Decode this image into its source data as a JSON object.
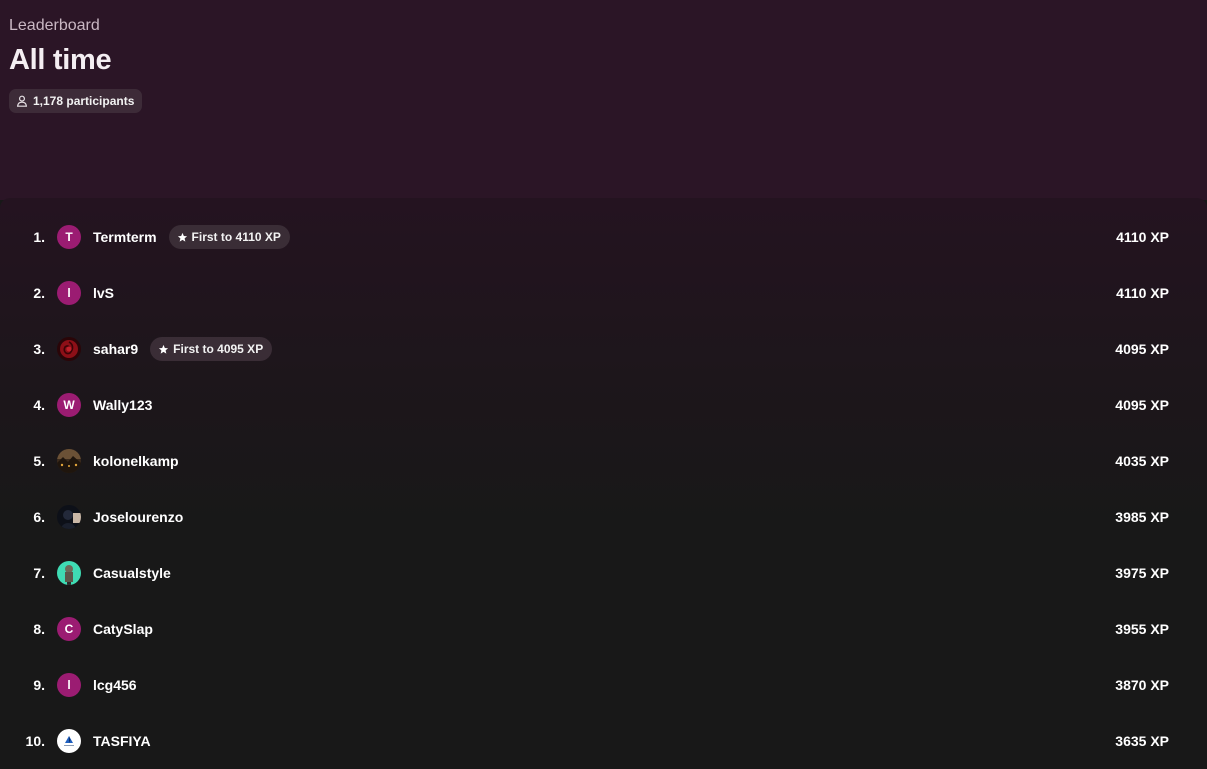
{
  "header": {
    "eyebrow": "Leaderboard",
    "title": "All time",
    "participants": "1,178 participants"
  },
  "colors": {
    "header_bg": "#2b1526",
    "panel_bg": "#181818",
    "avatar_default": "#9b1c72",
    "badge_bg": "#3a2d36"
  },
  "leaderboard": [
    {
      "rank": "1.",
      "name": "Termterm",
      "initial": "T",
      "avatar": "initial",
      "badge": "First to 4110 XP",
      "xp": "4110 XP"
    },
    {
      "rank": "2.",
      "name": "lvS",
      "initial": "l",
      "avatar": "initial",
      "badge": "",
      "xp": "4110 XP"
    },
    {
      "rank": "3.",
      "name": "sahar9",
      "initial": "",
      "avatar": "rose-image",
      "badge": "First to 4095 XP",
      "xp": "4095 XP"
    },
    {
      "rank": "4.",
      "name": "Wally123",
      "initial": "W",
      "avatar": "initial",
      "badge": "",
      "xp": "4095 XP"
    },
    {
      "rank": "5.",
      "name": "kolonelkamp",
      "initial": "",
      "avatar": "landscape-image",
      "badge": "",
      "xp": "4035 XP"
    },
    {
      "rank": "6.",
      "name": "Joselourenzo",
      "initial": "",
      "avatar": "dark-portrait-image",
      "badge": "",
      "xp": "3985 XP"
    },
    {
      "rank": "7.",
      "name": "Casualstyle",
      "initial": "",
      "avatar": "figure-image",
      "badge": "",
      "xp": "3975 XP"
    },
    {
      "rank": "8.",
      "name": "CatySlap",
      "initial": "C",
      "avatar": "initial",
      "badge": "",
      "xp": "3955 XP"
    },
    {
      "rank": "9.",
      "name": "lcg456",
      "initial": "l",
      "avatar": "initial",
      "badge": "",
      "xp": "3870 XP"
    },
    {
      "rank": "10.",
      "name": "TASFIYA",
      "initial": "",
      "avatar": "logo-image",
      "badge": "",
      "xp": "3635 XP"
    }
  ]
}
